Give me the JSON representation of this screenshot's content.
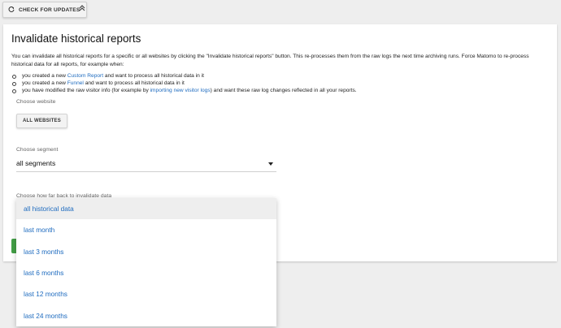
{
  "toolbar": {
    "check_updates_label": "CHECK FOR UPDATES"
  },
  "panel": {
    "title": "Invalidate historical reports",
    "intro": "You can invalidate all historical reports for a specific or all websites by clicking the \"Invalidate historical reports\" button. This re-processes them from the raw logs the next time archiving runs. Force Matomo to re-process historical data for all reports, for example when:",
    "bullets": [
      {
        "pre": "you created a new ",
        "link": "Custom Report",
        "post": " and want to process all historical data in it"
      },
      {
        "pre": "you created a new ",
        "link": "Funnel",
        "post": " and want to process all historical data in it"
      },
      {
        "pre": "you have modified the raw visitor info (for example by ",
        "link": "importing new visitor logs",
        "post": ") and want these raw log changes reflected in all your reports."
      }
    ],
    "choose_website_label": "Choose website",
    "all_websites_label": "ALL WEBSITES",
    "choose_segment_label": "Choose segment",
    "segment_value": "all segments",
    "choose_back_label": "Choose how far back to invalidate data"
  },
  "dropdown": {
    "options": [
      "all historical data",
      "last month",
      "last 3 months",
      "last 6 months",
      "last 12 months",
      "last 24 months"
    ],
    "highlighted_index": 0
  },
  "colors": {
    "link": "#1e6bbf",
    "submit_green": "#43a047"
  },
  "icons": [
    "refresh-icon",
    "chevron-up-double-icon",
    "caret-down-icon",
    "bullet-icon"
  ]
}
